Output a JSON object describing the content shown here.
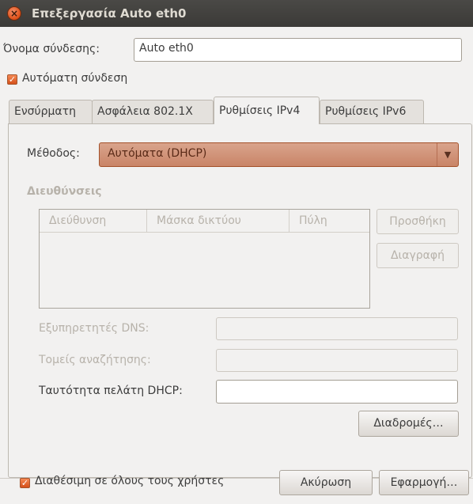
{
  "window": {
    "title": "Επεξεργασία Auto eth0",
    "close_icon": "×"
  },
  "connection": {
    "name_label": "Όνομα σύνδεσης:",
    "name_value": "Auto eth0"
  },
  "auto_connect": {
    "label": "Αυτόματη σύνδεση",
    "checked": true,
    "check_glyph": "✓"
  },
  "tabs": [
    {
      "label": "Ενσύρματη"
    },
    {
      "label": "Ασφάλεια 802.1X"
    },
    {
      "label": "Ρυθμίσεις IPv4",
      "active": true
    },
    {
      "label": "Ρυθμίσεις IPv6"
    }
  ],
  "ipv4": {
    "method_label": "Μέθοδος:",
    "method_value": "Αυτόματα (DHCP)",
    "combo_arrow": "▼",
    "addresses_heading": "Διευθύνσεις",
    "columns": [
      "Διεύθυνση",
      "Μάσκα δικτύου",
      "Πύλη"
    ],
    "add_button": "Προσθήκη",
    "delete_button": "Διαγραφή",
    "dns_label": "Εξυπηρετητές DNS:",
    "dns_value": "",
    "search_label": "Τομείς αναζήτησης:",
    "search_value": "",
    "dhcp_id_label": "Ταυτότητα πελάτη DHCP:",
    "dhcp_id_value": "",
    "routes_button": "Διαδρομές…"
  },
  "footer": {
    "available_all_label": "Διαθέσιμη σε όλους τους χρήστες",
    "available_all_checked": true,
    "cancel_button": "Ακύρωση",
    "apply_button": "Εφαρμογή…"
  },
  "colors": {
    "accent": "#e0531c",
    "titlebar": "#3c3b37",
    "combo": "#d09677"
  }
}
